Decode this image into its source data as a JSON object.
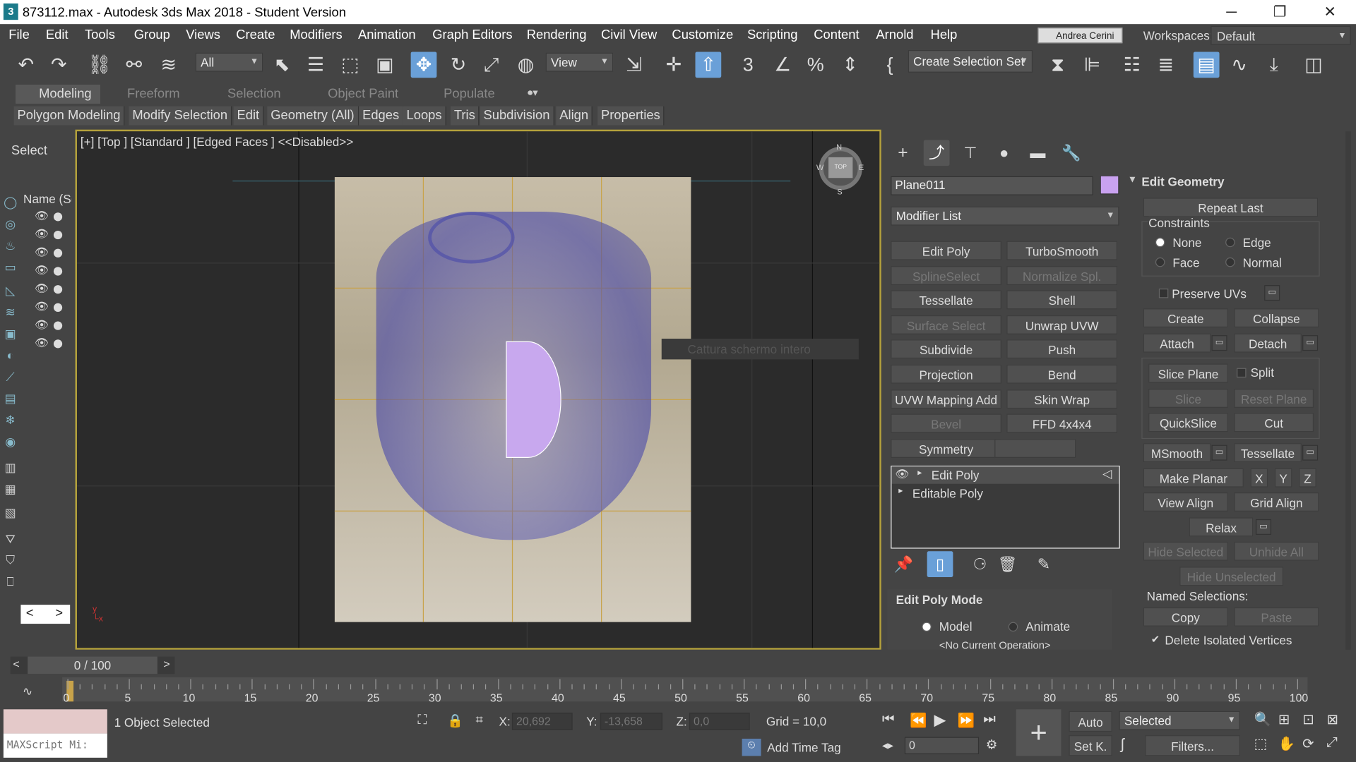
{
  "window": {
    "title": "873112.max - Autodesk 3ds Max 2018 - Student Version",
    "minimize": "─",
    "restore": "❐",
    "close": "✕"
  },
  "menu": [
    "File",
    "Edit",
    "Tools",
    "Group",
    "Views",
    "Create",
    "Modifiers",
    "Animation",
    "Graph Editors",
    "Rendering",
    "Civil View",
    "Customize",
    "Scripting",
    "Content",
    "Arnold",
    "Help"
  ],
  "user": "Andrea Cerini",
  "workspaces": {
    "label": "Workspaces:",
    "value": "Default"
  },
  "toolbar": {
    "selection_filter": "All",
    "ref_coord": "View",
    "selection_set": "Create Selection Set"
  },
  "ribbon": {
    "tabs": [
      "Modeling",
      "Freeform",
      "Selection",
      "Object Paint",
      "Populate"
    ],
    "subtabs": [
      "Polygon Modeling",
      "Modify Selection",
      "Edit",
      "Geometry (All)",
      "Edges",
      "Loops",
      "Tris",
      "Subdivision",
      "Align",
      "Properties"
    ]
  },
  "scene_explorer": {
    "select_label": "Select",
    "name_col": "Name (Sc",
    "nav_prev": "<",
    "nav_next": ">"
  },
  "viewport": {
    "label": "[+] [Top ] [Standard ] [Edged Faces ]  <<Disabled>>",
    "capture_text": "Cattura schermo intero",
    "compass": {
      "n": "N",
      "s": "S",
      "e": "E",
      "w": "W",
      "top": "TOP"
    }
  },
  "command_panel": {
    "object_name": "Plane011",
    "object_color": "#c9a2f0",
    "modifier_list": "Modifier List",
    "modifier_buttons": [
      {
        "label": "Edit Poly",
        "enabled": true
      },
      {
        "label": "TurboSmooth",
        "enabled": true
      },
      {
        "label": "SplineSelect",
        "enabled": false
      },
      {
        "label": "Normalize Spl.",
        "enabled": false
      },
      {
        "label": "Tessellate",
        "enabled": true
      },
      {
        "label": "Shell",
        "enabled": true
      },
      {
        "label": "Surface Select",
        "enabled": false
      },
      {
        "label": "Unwrap UVW",
        "enabled": true
      },
      {
        "label": "Subdivide",
        "enabled": true
      },
      {
        "label": "Push",
        "enabled": true
      },
      {
        "label": "Projection",
        "enabled": true
      },
      {
        "label": "Bend",
        "enabled": true
      },
      {
        "label": "UVW Mapping Add",
        "enabled": true
      },
      {
        "label": "Skin Wrap",
        "enabled": true
      },
      {
        "label": "Bevel",
        "enabled": false
      },
      {
        "label": "FFD 4x4x4",
        "enabled": true
      },
      {
        "label": "Symmetry",
        "enabled": true
      },
      {
        "label": "",
        "enabled": true
      }
    ],
    "stack": [
      "Edit Poly",
      "Editable Poly"
    ],
    "edit_poly_mode": {
      "title": "Edit Poly Mode",
      "model": "Model",
      "animate": "Animate",
      "current_op": "<No Current Operation>"
    },
    "edit_geometry": {
      "title": "Edit Geometry",
      "repeat_last": "Repeat Last",
      "constraints": "Constraints",
      "none": "None",
      "edge": "Edge",
      "face": "Face",
      "normal": "Normal",
      "preserve_uvs": "Preserve UVs",
      "create": "Create",
      "collapse": "Collapse",
      "attach": "Attach",
      "detach": "Detach",
      "slice_plane": "Slice Plane",
      "split": "Split",
      "slice": "Slice",
      "reset_plane": "Reset Plane",
      "quickslice": "QuickSlice",
      "cut": "Cut",
      "msmooth": "MSmooth",
      "tessellate": "Tessellate",
      "make_planar": "Make Planar",
      "x": "X",
      "y": "Y",
      "z": "Z",
      "view_align": "View Align",
      "grid_align": "Grid Align",
      "relax": "Relax",
      "hide_selected": "Hide Selected",
      "unhide_all": "Unhide All",
      "hide_unselected": "Hide Unselected",
      "named_selections": "Named Selections:",
      "copy": "Copy",
      "paste": "Paste",
      "delete_isolated": "Delete Isolated Vertices"
    }
  },
  "timeline": {
    "frame": "0 / 100",
    "prev": "<",
    "next": ">",
    "ticks": [
      "0",
      "5",
      "10",
      "15",
      "20",
      "25",
      "30",
      "35",
      "40",
      "45",
      "50",
      "55",
      "60",
      "65",
      "70",
      "75",
      "80",
      "85",
      "90",
      "95",
      "100"
    ]
  },
  "status": {
    "maxscript": "MAXScript Mi:",
    "selected": "1 Object Selected",
    "x_label": "X:",
    "x": "20,692",
    "y_label": "Y:",
    "y": "-13,658",
    "z_label": "Z:",
    "z": "0,0",
    "grid": "Grid = 10,0",
    "add_time_tag": "Add Time Tag",
    "auto": "Auto",
    "set_key": "Set K.",
    "key_filter": "Selected",
    "filters": "Filters...",
    "frame_spinner": "0"
  }
}
